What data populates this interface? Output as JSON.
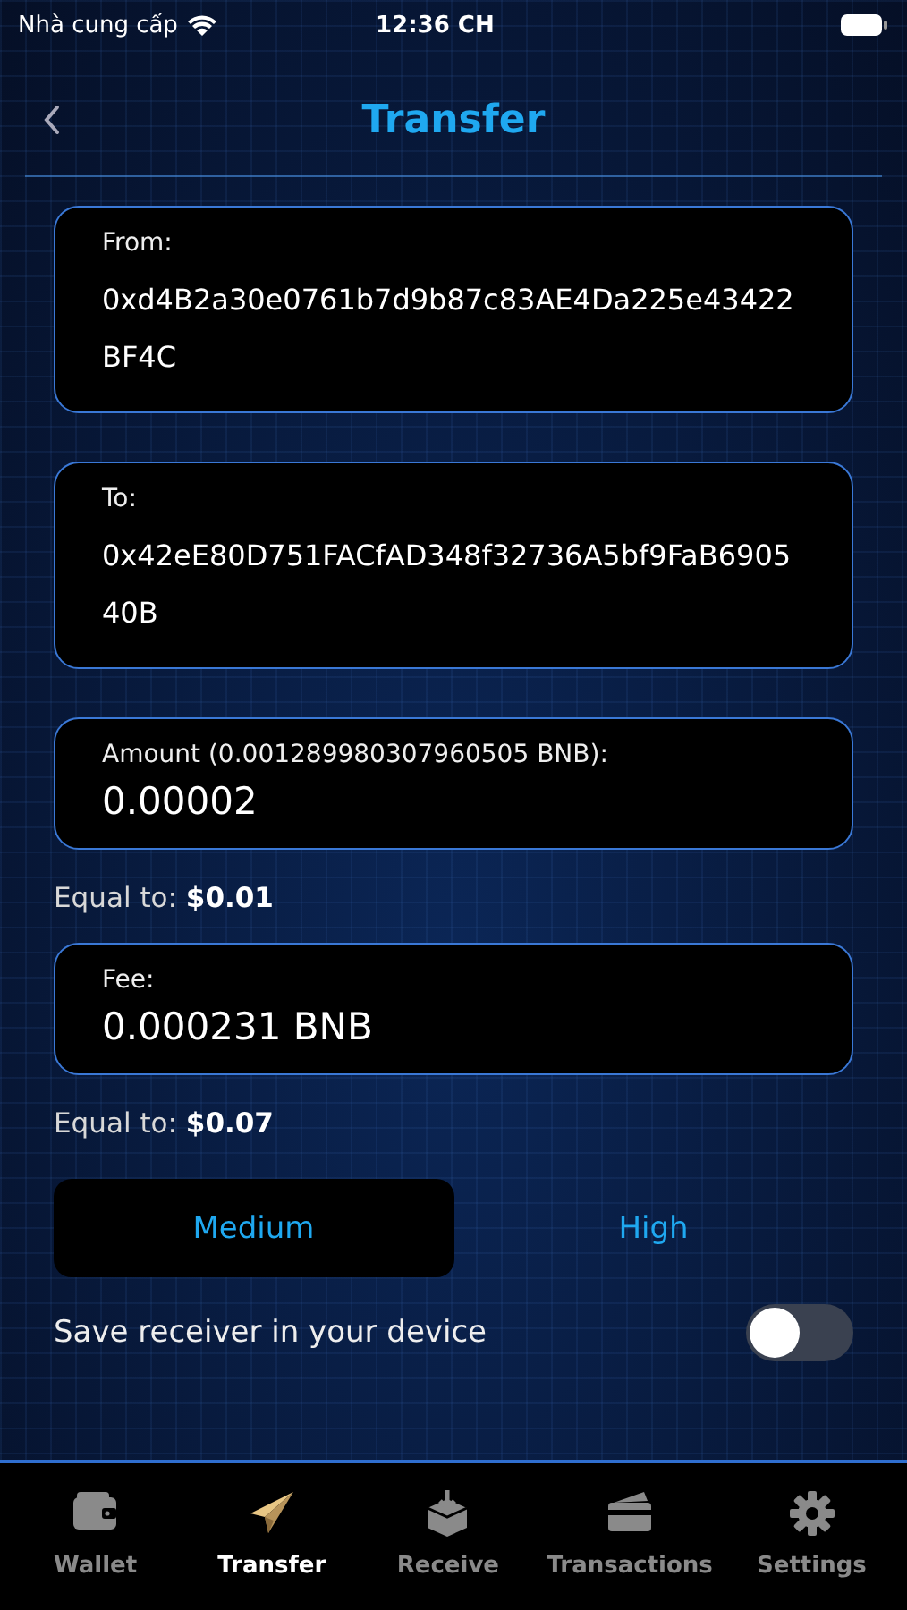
{
  "status_bar": {
    "carrier": "Nhà cung cấp",
    "time": "12:36 CH"
  },
  "header": {
    "title": "Transfer"
  },
  "fields": [
    {
      "kind": "address",
      "label": "From:",
      "value": "0xd4B2a30e0761b7d9b87c83AE4Da225e43422BF4C"
    },
    {
      "kind": "address",
      "label": "To:",
      "value": "0x42eE80D751FACfAD348f32736A5bf9FaB690540B"
    },
    {
      "kind": "amount",
      "label": "Amount (0.001289980307960505 BNB):",
      "value": "0.00002",
      "equal_label": "Equal to:",
      "equal_value": "$0.01"
    },
    {
      "kind": "amount",
      "label": "Fee:",
      "value": "0.000231 BNB",
      "equal_label": "Equal to:",
      "equal_value": "$0.07"
    }
  ],
  "fee_options": [
    {
      "label": "Medium",
      "selected": true
    },
    {
      "label": "High",
      "selected": false
    }
  ],
  "save_receiver": {
    "label": "Save receiver in your device",
    "on": false
  },
  "tab_bar": [
    {
      "label": "Wallet",
      "kind": "wallet",
      "selected": false
    },
    {
      "label": "Transfer",
      "kind": "plane",
      "selected": true
    },
    {
      "label": "Receive",
      "kind": "receive",
      "selected": false
    },
    {
      "label": "Transactions",
      "kind": "card",
      "selected": false
    },
    {
      "label": "Settings",
      "kind": "gear",
      "selected": false
    }
  ]
}
